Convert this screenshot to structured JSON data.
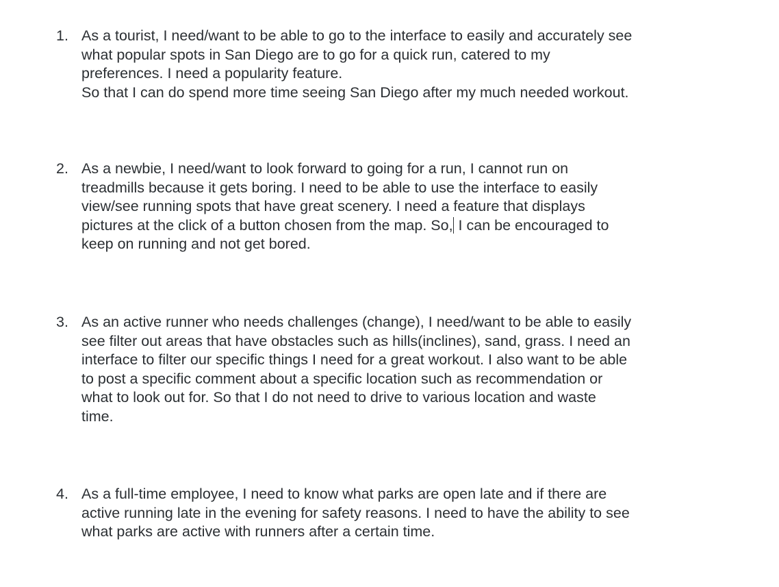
{
  "stories": [
    {
      "number": "1.",
      "lines": [
        "As a tourist, I need/want to be able to go to the interface to easily and accurately see",
        "what popular spots in San Diego are to go for a quick run, catered to my",
        "preferences. I need a popularity feature.",
        "So that I can do spend more time seeing San Diego after my much needed workout."
      ]
    },
    {
      "number": "2.",
      "lines": [
        "As a newbie, I need/want to look forward to going for a run, I cannot run on",
        "treadmills because it gets boring. I need to be able to use the interface to easily",
        "view/see running spots that have great scenery. I need a feature that displays",
        "keep on running and not get bored."
      ],
      "caret_line": {
        "before": "pictures at the click of a button chosen from the map. So,",
        "after": " I can be encouraged to"
      }
    },
    {
      "number": "3.",
      "lines": [
        "As an active runner who needs challenges (change), I need/want to be able to easily",
        "see filter out areas that have obstacles such as hills(inclines), sand, grass. I need an",
        "interface to filter our specific things I need for a great workout. I also want to be able",
        "to post a specific comment about a specific location such as recommendation or",
        "what to look out for. So that I do not need to drive to various location and waste",
        "time."
      ]
    },
    {
      "number": "4.",
      "lines": [
        "As a full-time employee, I need to know what parks are open late and if there are",
        "active running late in the evening for safety reasons. I need to have the ability to see",
        "what parks are active with runners after a certain time."
      ]
    }
  ]
}
